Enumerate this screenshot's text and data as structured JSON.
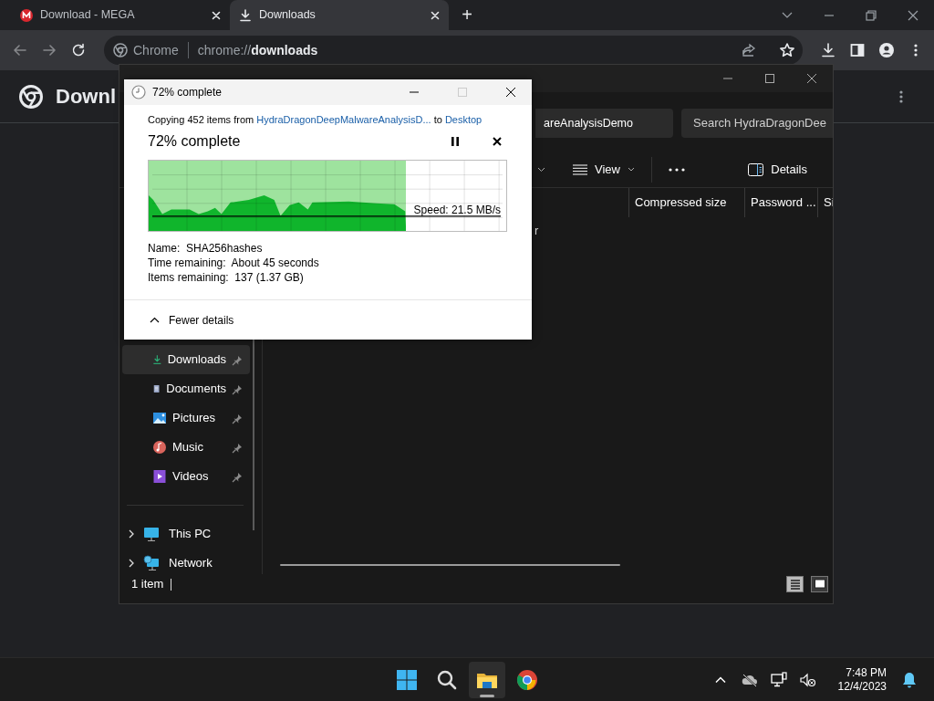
{
  "browser": {
    "tabs": [
      {
        "title": "Download - MEGA",
        "kind": "mega",
        "selected": false
      },
      {
        "title": "Downloads",
        "kind": "download",
        "selected": true
      }
    ],
    "new_tab": "+",
    "omnibox": {
      "site": "Chrome",
      "url": "chrome://**downloads**"
    },
    "page_title": "Downl"
  },
  "explorer": {
    "address": "areAnalysisDemo",
    "search_placeholder": "Search HydraDragonDee",
    "view_label": "View",
    "details_label": "Details",
    "columns": [
      "Compressed size",
      "Password ...",
      "Si"
    ],
    "row_fragment": "r",
    "quick_access": [
      {
        "label": "Downloads",
        "kind": "downloads",
        "selected": true,
        "pinned": true
      },
      {
        "label": "Documents",
        "kind": "documents",
        "selected": false,
        "pinned": true
      },
      {
        "label": "Pictures",
        "kind": "pictures",
        "selected": false,
        "pinned": true
      },
      {
        "label": "Music",
        "kind": "music",
        "selected": false,
        "pinned": true
      },
      {
        "label": "Videos",
        "kind": "videos",
        "selected": false,
        "pinned": true
      }
    ],
    "locations": [
      {
        "label": "This PC",
        "kind": "pc"
      },
      {
        "label": "Network",
        "kind": "network"
      }
    ],
    "status": "1 item",
    "view_modes": [
      {
        "kind": "details",
        "selected": true
      },
      {
        "kind": "tiles",
        "selected": false
      }
    ]
  },
  "dialog": {
    "title": "72% complete",
    "copy_prefix": "Copying 452 items from",
    "source": "HydraDragonDeepMalwareAnalysisD...",
    "joiner": "to",
    "destination": "Desktop",
    "heading": "72% complete",
    "progress": {
      "level": 0.72
    },
    "speed": "Speed: 21.5 MB/s",
    "details": [
      "Name:  SHA256hashes",
      "Time remaining:  About 45 seconds",
      "Items remaining:  137 (1.37 GB)"
    ],
    "toggle": "Fewer details"
  },
  "taskbar": {
    "apps": [
      {
        "kind": "start",
        "selected": false
      },
      {
        "kind": "search",
        "selected": false
      },
      {
        "kind": "explorer",
        "selected": true
      },
      {
        "kind": "chrome",
        "selected": false
      }
    ],
    "time": "7:48 PM",
    "date": "12/4/2023"
  }
}
